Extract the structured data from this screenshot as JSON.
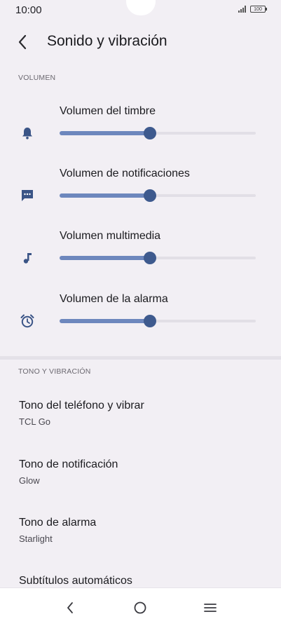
{
  "status_bar": {
    "time": "10:00",
    "battery": "100"
  },
  "header": {
    "title": "Sonido y vibración"
  },
  "volume_section": {
    "header": "VOLUMEN",
    "items": [
      {
        "label": "Volumen del timbre",
        "icon": "bell-icon",
        "level": 0.46
      },
      {
        "label": "Volumen de notificaciones",
        "icon": "message-icon",
        "level": 0.46
      },
      {
        "label": "Volumen multimedia",
        "icon": "music-note-icon",
        "level": 0.46
      },
      {
        "label": "Volumen de la alarma",
        "icon": "alarm-clock-icon",
        "level": 0.46
      }
    ]
  },
  "tone_section": {
    "header": "TONO Y VIBRACIÓN",
    "items": [
      {
        "title": "Tono del teléfono y vibrar",
        "subtitle": "TCL Go"
      },
      {
        "title": "Tono de notificación",
        "subtitle": "Glow"
      },
      {
        "title": "Tono de alarma",
        "subtitle": "Starlight"
      },
      {
        "title": "Subtítulos automáticos",
        "subtitle": ""
      }
    ]
  },
  "colors": {
    "background": "#f2eff4",
    "accent": "#3e5a8e",
    "slider_fill": "#6d87bd",
    "slider_track": "#e2dfe6"
  }
}
